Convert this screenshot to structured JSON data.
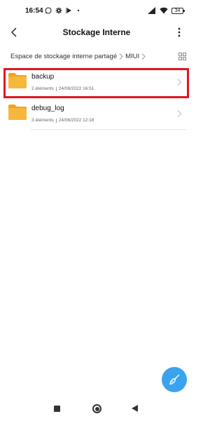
{
  "status_bar": {
    "time": "16:54",
    "left_icons": [
      "whatsapp-icon",
      "settings-icon",
      "media-icon",
      "dot-icon"
    ],
    "right_icons": [
      "signal-icon",
      "wifi-icon",
      "battery-icon"
    ],
    "battery_level": "34"
  },
  "header": {
    "title": "Stockage Interne"
  },
  "breadcrumb": {
    "items": [
      "Espace de stockage interne partagé",
      "MIUI"
    ]
  },
  "files": [
    {
      "name": "backup",
      "count": "2 éléments",
      "date": "24/06/2022 16:51",
      "icon": "folder-icon",
      "highlighted": true
    },
    {
      "name": "debug_log",
      "count": "3 éléments",
      "date": "24/06/2022 12:18",
      "icon": "folder-icon",
      "highlighted": false
    }
  ],
  "colors": {
    "folder": "#f7b73d",
    "folder_back": "#f2a31c",
    "highlight": "#e0161f",
    "fab": "#3aa3ee"
  },
  "fab": {
    "icon": "cleaner-brush-icon"
  },
  "nav_bar": {
    "icons": [
      "recents-icon",
      "home-icon",
      "back-icon"
    ]
  }
}
